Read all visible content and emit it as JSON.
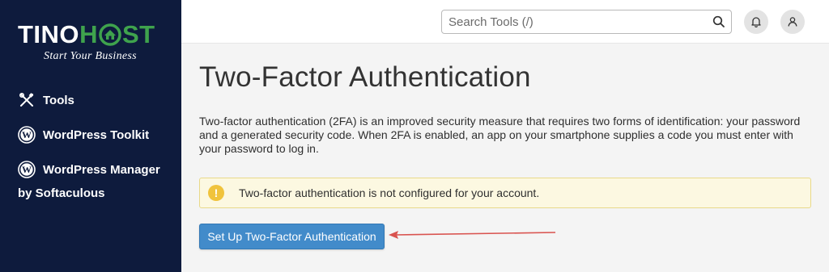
{
  "sidebar": {
    "logo": {
      "part1": "TINO",
      "part2": "H",
      "part3": "ST",
      "tagline": "Start Your Business"
    },
    "items": [
      {
        "label": "Tools",
        "icon": "tools-icon"
      },
      {
        "label": "WordPress Toolkit",
        "icon": "wordpress-icon"
      },
      {
        "label": "WordPress Manager",
        "label_line2": "by Softaculous",
        "icon": "wordpress-icon"
      }
    ]
  },
  "header": {
    "search_placeholder": "Search Tools (/)",
    "icons": [
      "search-icon",
      "bell-icon",
      "user-icon"
    ]
  },
  "main": {
    "title": "Two-Factor Authentication",
    "description": "Two-factor authentication (2FA) is an improved security measure that requires two forms of identification: your password and a generated security code. When 2FA is enabled, an app on your smartphone supplies a code you must enter with your password to log in.",
    "alert": {
      "icon": "!",
      "text": "Two-factor authentication is not configured for your account."
    },
    "setup_button": "Set Up Two-Factor Authentication"
  },
  "colors": {
    "sidebar_bg": "#0e1b3d",
    "logo_green": "#3fa34d",
    "primary_button": "#428bca",
    "alert_bg": "#fcf8e1",
    "alert_icon": "#f0c33c",
    "arrow": "#d9534f"
  }
}
